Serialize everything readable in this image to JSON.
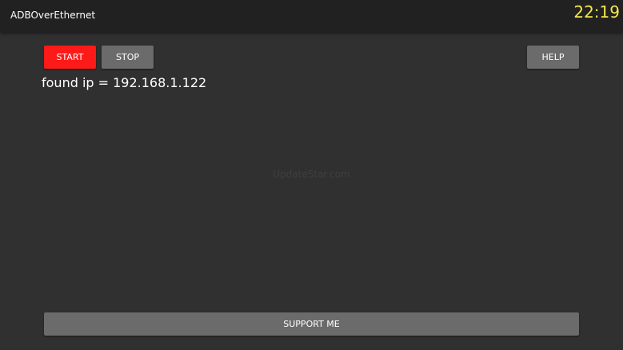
{
  "app_bar": {
    "title": "ADBOverEthernet",
    "clock": "22:19"
  },
  "controls": {
    "start_label": "START",
    "stop_label": "STOP",
    "help_label": "HELP"
  },
  "status": {
    "found_ip": "found ip = 192.168.1.122"
  },
  "watermark": "UpdateStar.com",
  "footer": {
    "support_label": "SUPPORT ME"
  },
  "colors": {
    "background": "#303030",
    "app_bar": "#212121",
    "start_button": "#ff1a1a",
    "gray_button": "#6b6b6b",
    "clock": "#f5e64a"
  }
}
